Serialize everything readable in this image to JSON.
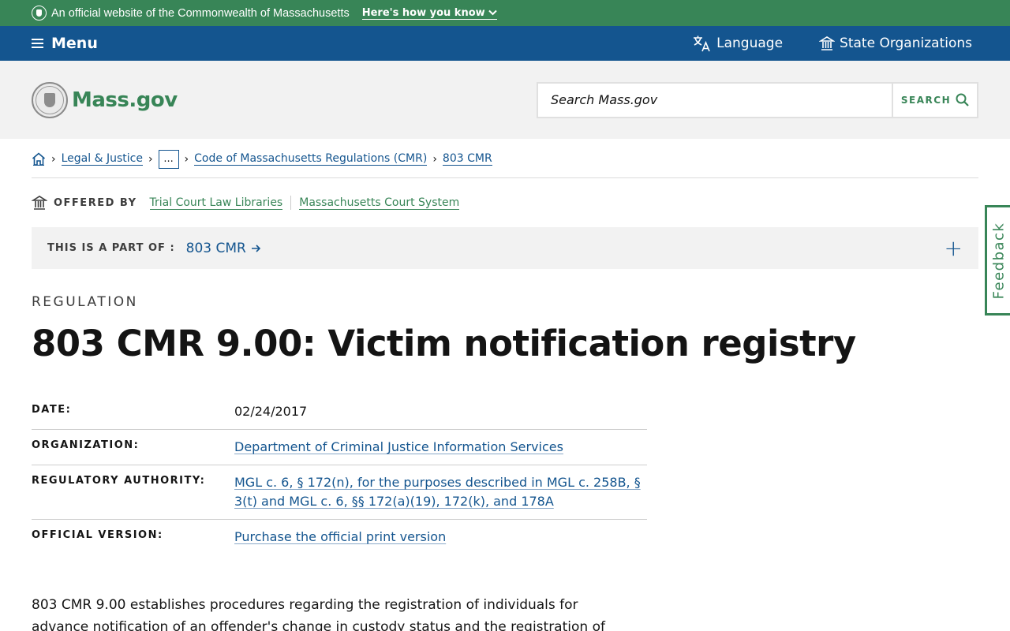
{
  "banner": {
    "official_text": "An official website of the Commonwealth of Massachusetts",
    "how_link": "Here's how you know"
  },
  "navbar": {
    "menu_label": "Menu",
    "language_label": "Language",
    "state_orgs_label": "State Organizations"
  },
  "header": {
    "logo_text": "Mass.gov",
    "search_placeholder": "Search Mass.gov",
    "search_button": "SEARCH"
  },
  "breadcrumbs": {
    "items": [
      "Legal & Justice",
      "...",
      "Code of Massachusetts Regulations (CMR)",
      "803 CMR"
    ]
  },
  "offered_by": {
    "label": "OFFERED BY",
    "orgs": [
      "Trial Court Law Libraries",
      "Massachusetts Court System"
    ]
  },
  "part_of": {
    "label": "THIS IS A PART OF :",
    "link": "803 CMR",
    "expand": "+"
  },
  "main": {
    "category": "REGULATION",
    "title": "803 CMR 9.00: Victim notification registry",
    "details": [
      {
        "key": "DATE:",
        "value": "02/24/2017"
      },
      {
        "key": "ORGANIZATION:",
        "value": "Department of Criminal Justice Information Services"
      },
      {
        "key": "REGULATORY AUTHORITY:",
        "value": "MGL c. 6, § 172(n), for the purposes described in MGL c. 258B, § 3(t) and MGL c. 6, §§ 172(a)(19), 172(k), and 178A"
      },
      {
        "key": "OFFICIAL VERSION:",
        "value": "Purchase the official print version"
      }
    ],
    "intro": "803 CMR 9.00 establishes procedures regarding the registration of individuals for advance notification of an offender's change in custody status and the registration of"
  },
  "feedback": {
    "label": "Feedback"
  },
  "colors": {
    "banner_green": "#388557",
    "nav_blue": "#14558f",
    "header_gray": "#f2f2f2",
    "link_blue": "#14558f"
  }
}
